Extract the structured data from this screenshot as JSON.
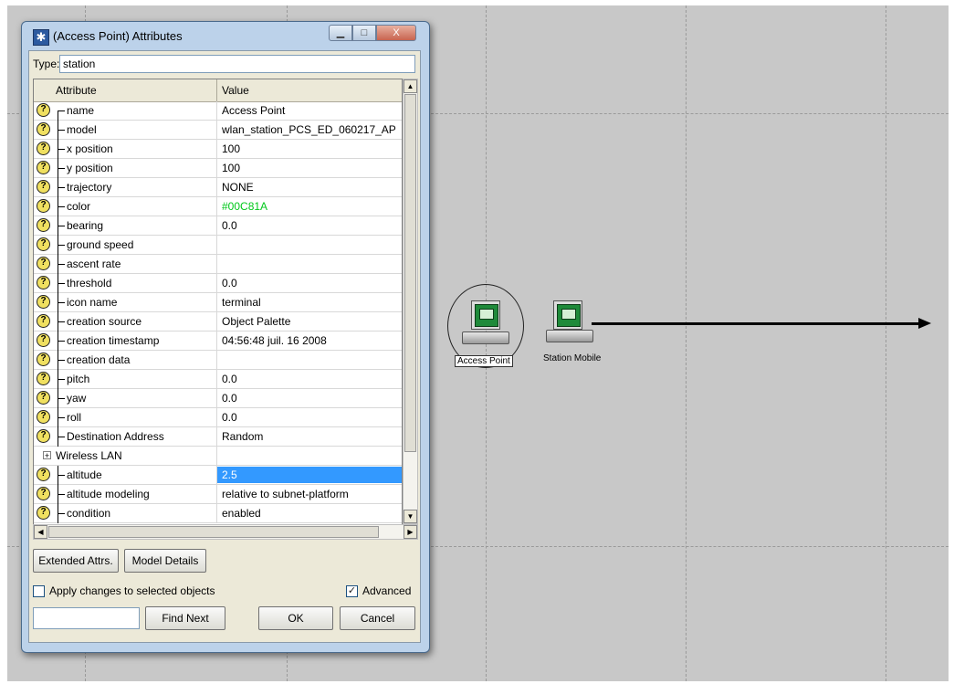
{
  "window": {
    "title": "(Access Point) Attributes",
    "controls": {
      "minimize": "▁",
      "maximize": "□",
      "close": "X"
    }
  },
  "type": {
    "label": "Type:",
    "value": "station"
  },
  "grid": {
    "headers": {
      "attribute": "Attribute",
      "value": "Value"
    },
    "rows": [
      {
        "name": "name",
        "value": "Access Point"
      },
      {
        "name": "model",
        "value": "wlan_station_PCS_ED_060217_AP"
      },
      {
        "name": "x position",
        "value": "100"
      },
      {
        "name": "y position",
        "value": "100"
      },
      {
        "name": "trajectory",
        "value": "NONE"
      },
      {
        "name": "color",
        "value": "#00C81A"
      },
      {
        "name": "bearing",
        "value": "0.0"
      },
      {
        "name": "ground speed",
        "value": ""
      },
      {
        "name": "ascent rate",
        "value": ""
      },
      {
        "name": "threshold",
        "value": "0.0"
      },
      {
        "name": "icon name",
        "value": "terminal"
      },
      {
        "name": "creation source",
        "value": "Object Palette"
      },
      {
        "name": "creation timestamp",
        "value": "04:56:48 juil. 16 2008"
      },
      {
        "name": "creation data",
        "value": ""
      },
      {
        "name": "pitch",
        "value": "0.0"
      },
      {
        "name": "yaw",
        "value": "0.0"
      },
      {
        "name": "roll",
        "value": "0.0"
      },
      {
        "name": "Destination Address",
        "value": "Random"
      },
      {
        "name": "Wireless LAN",
        "value": ""
      },
      {
        "name": "altitude",
        "value": "2.5"
      },
      {
        "name": "altitude modeling",
        "value": "relative to subnet-platform"
      },
      {
        "name": "condition",
        "value": "enabled"
      }
    ],
    "expander_symbol": "+",
    "help_symbol": "?"
  },
  "buttons": {
    "extended_attrs": "Extended Attrs.",
    "model_details": "Model Details",
    "find_next": "Find Next",
    "ok": "OK",
    "cancel": "Cancel"
  },
  "options": {
    "apply_changes": "Apply changes to selected objects",
    "apply_changes_checked": false,
    "advanced": "Advanced",
    "advanced_checked": true
  },
  "find_field": {
    "value": ""
  },
  "canvas": {
    "nodes": [
      {
        "label": "Access Point"
      },
      {
        "label": "Station Mobile"
      }
    ]
  }
}
